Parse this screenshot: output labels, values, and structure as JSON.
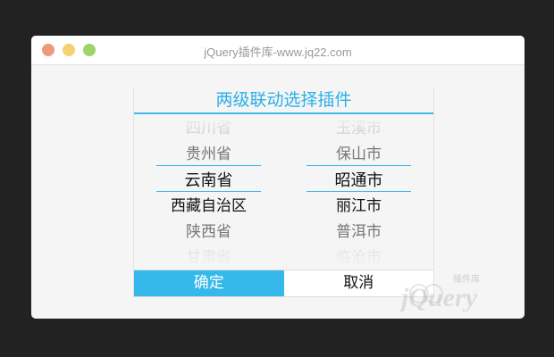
{
  "window": {
    "title": "jQuery插件库-www.jq22.com",
    "traffic_colors": {
      "close": "#ee9a7a",
      "minimize": "#f4d36e",
      "zoom": "#9fd36b"
    }
  },
  "picker": {
    "title": "两级联动选择插件",
    "provinces": [
      "四川省",
      "贵州省",
      "云南省",
      "西藏自治区",
      "陕西省",
      "甘肃省"
    ],
    "cities": [
      "玉溪市",
      "保山市",
      "昭通市",
      "丽江市",
      "普洱市",
      "临沧市"
    ],
    "selected_province": "云南省",
    "selected_city": "昭通市",
    "confirm_label": "确定",
    "cancel_label": "取消"
  },
  "watermark": {
    "text": "jQuery",
    "subtext": "插件库",
    "icon": "jquery-logo-icon"
  },
  "colors": {
    "accent": "#35b8ea",
    "title": "#2bb0e6"
  }
}
